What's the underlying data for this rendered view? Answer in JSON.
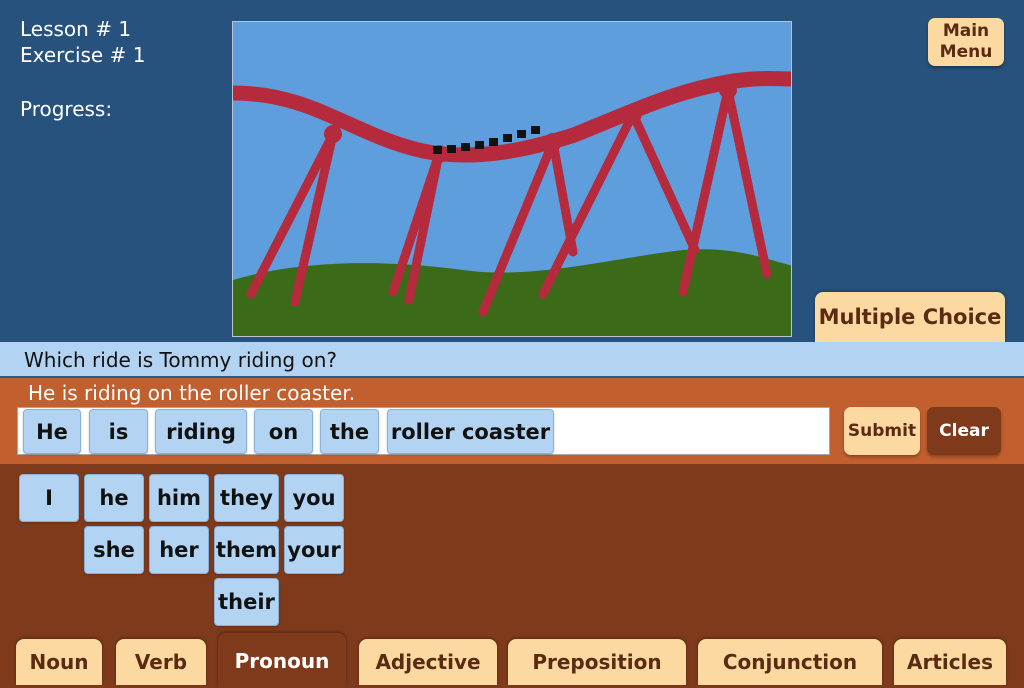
{
  "header": {
    "lesson": "Lesson # 1",
    "exercise": "Exercise # 1",
    "progress_label": "Progress:",
    "main_menu_label": "Main\nMenu"
  },
  "mode_button": "Multiple Choice",
  "question": "Which ride is Tommy riding on?",
  "answer_hint": "He is riding on the roller coaster.",
  "answer_words": [
    "He",
    "is",
    "riding",
    "on",
    "the",
    "roller coaster"
  ],
  "actions": {
    "submit": "Submit",
    "clear": "Clear"
  },
  "word_bank": {
    "row1": [
      "I",
      "he",
      "him",
      "they",
      "you"
    ],
    "row2": [
      "she",
      "her",
      "them",
      "your"
    ],
    "row3": [
      "their"
    ]
  },
  "tabs": [
    "Noun",
    "Verb",
    "Pronoun",
    "Adjective",
    "Preposition",
    "Conjunction",
    "Articles"
  ],
  "active_tab": "Pronoun",
  "colors": {
    "background": "#27527d",
    "button_light": "#fcd9a1",
    "button_dark": "#7f3a1c",
    "answer_panel": "#c25f2f",
    "word_tile": "#b2d4f2"
  }
}
